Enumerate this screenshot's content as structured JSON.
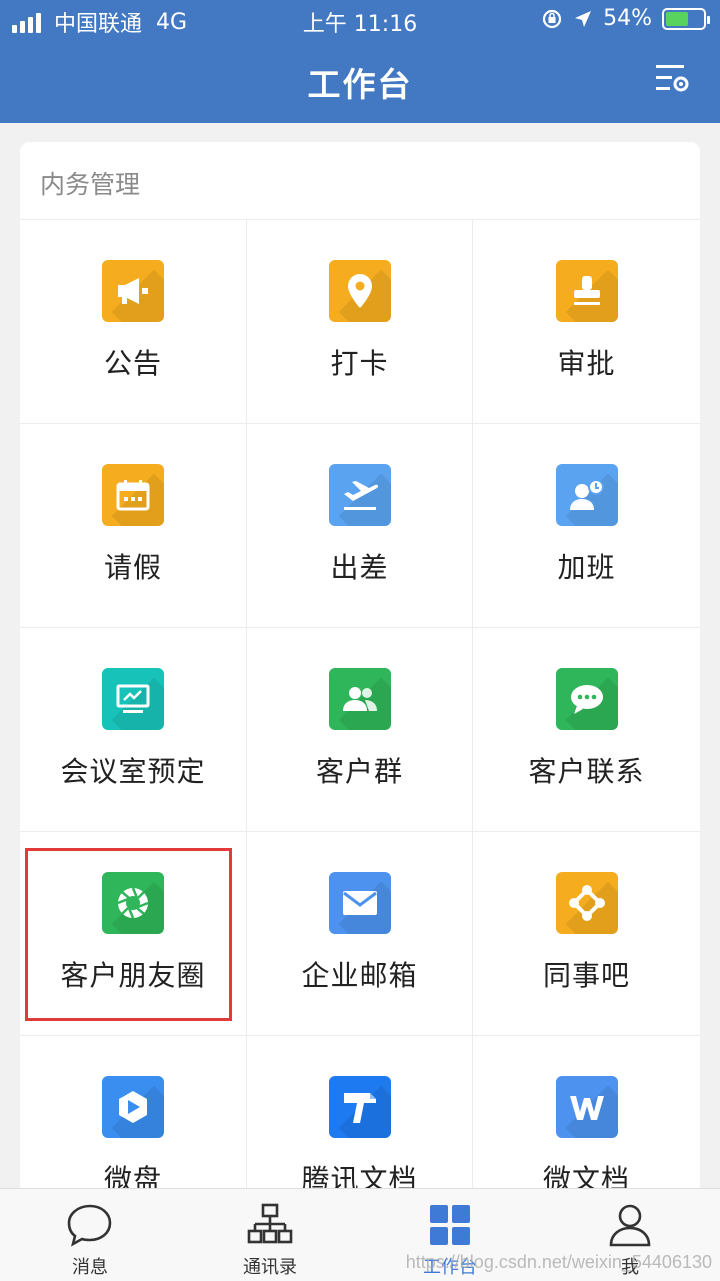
{
  "status": {
    "carrier": "中国联通",
    "network": "4G",
    "time": "上午 11:16",
    "battery": "54%",
    "battery_level": 0.54
  },
  "header": {
    "title": "工作台",
    "settings_icon": "settings-list-icon"
  },
  "section": {
    "title": "内务管理"
  },
  "apps": [
    {
      "label": "公告",
      "icon": "megaphone-icon",
      "color": "#f5ad1f"
    },
    {
      "label": "打卡",
      "icon": "location-pin-icon",
      "color": "#f5ad1f"
    },
    {
      "label": "审批",
      "icon": "stamp-icon",
      "color": "#f5ad1f"
    },
    {
      "label": "请假",
      "icon": "calendar-icon",
      "color": "#f5ad1f"
    },
    {
      "label": "出差",
      "icon": "airplane-icon",
      "color": "#5aa3f0"
    },
    {
      "label": "加班",
      "icon": "overtime-user-icon",
      "color": "#5aa3f0"
    },
    {
      "label": "会议室预定",
      "icon": "meeting-screen-icon",
      "color": "#17c3b9"
    },
    {
      "label": "客户群",
      "icon": "customer-group-icon",
      "color": "#2fb65a"
    },
    {
      "label": "客户联系",
      "icon": "chat-bubble-icon",
      "color": "#2fb65a"
    },
    {
      "label": "客户朋友圈",
      "icon": "aperture-icon",
      "color": "#2fb65a"
    },
    {
      "label": "企业邮箱",
      "icon": "mail-icon",
      "color": "#4c92ee"
    },
    {
      "label": "同事吧",
      "icon": "network-nodes-icon",
      "color": "#f5ad1f"
    },
    {
      "label": "微盘",
      "icon": "drive-icon",
      "color": "#3a8ef0"
    },
    {
      "label": "腾讯文档",
      "icon": "tencent-docs-icon",
      "color": "#1e7af0"
    },
    {
      "label": "微文档",
      "icon": "word-doc-icon",
      "color": "#4c92ee"
    }
  ],
  "tabs": [
    {
      "label": "消息",
      "icon": "chat-icon"
    },
    {
      "label": "通讯录",
      "icon": "org-chart-icon"
    },
    {
      "label": "工作台",
      "icon": "grid-icon",
      "active": true
    },
    {
      "label": "我",
      "icon": "person-icon"
    }
  ],
  "watermark": "https://blog.csdn.net/weixin_54406130",
  "colors": {
    "header": "#4378c2",
    "accent": "#3f7bd6",
    "highlight": "#e03a3a"
  }
}
